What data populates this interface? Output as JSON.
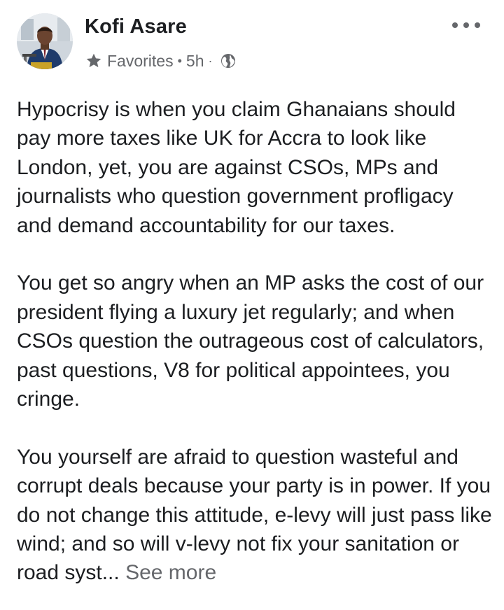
{
  "post": {
    "author": "Kofi Asare",
    "audience": "Favorites",
    "time": "5h",
    "paragraphs": [
      "Hypocrisy is when you claim Ghanaians should pay more taxes like UK for Accra to look like London, yet, you are against CSOs, MPs and journalists who question government profligacy and demand accountability for our taxes.",
      "You get so angry when an MP asks the cost of our president flying a luxury jet regularly; and when CSOs question the outrageous cost of calculators, past questions, V8 for political appointees, you cringe.",
      "You yourself are afraid to question wasteful and corrupt deals because your party is in power. If you do not change this attitude, e-levy will just pass like wind; and so will v-levy not fix your sanitation or road syst..."
    ],
    "see_more": "See more",
    "separator": "·"
  },
  "icons": {
    "audience_icon": "star-icon",
    "privacy_icon": "globe-icon",
    "menu_icon": "more-options-icon"
  },
  "colors": {
    "text_primary": "#1c1e21",
    "text_secondary": "#65676b",
    "background": "#ffffff"
  }
}
